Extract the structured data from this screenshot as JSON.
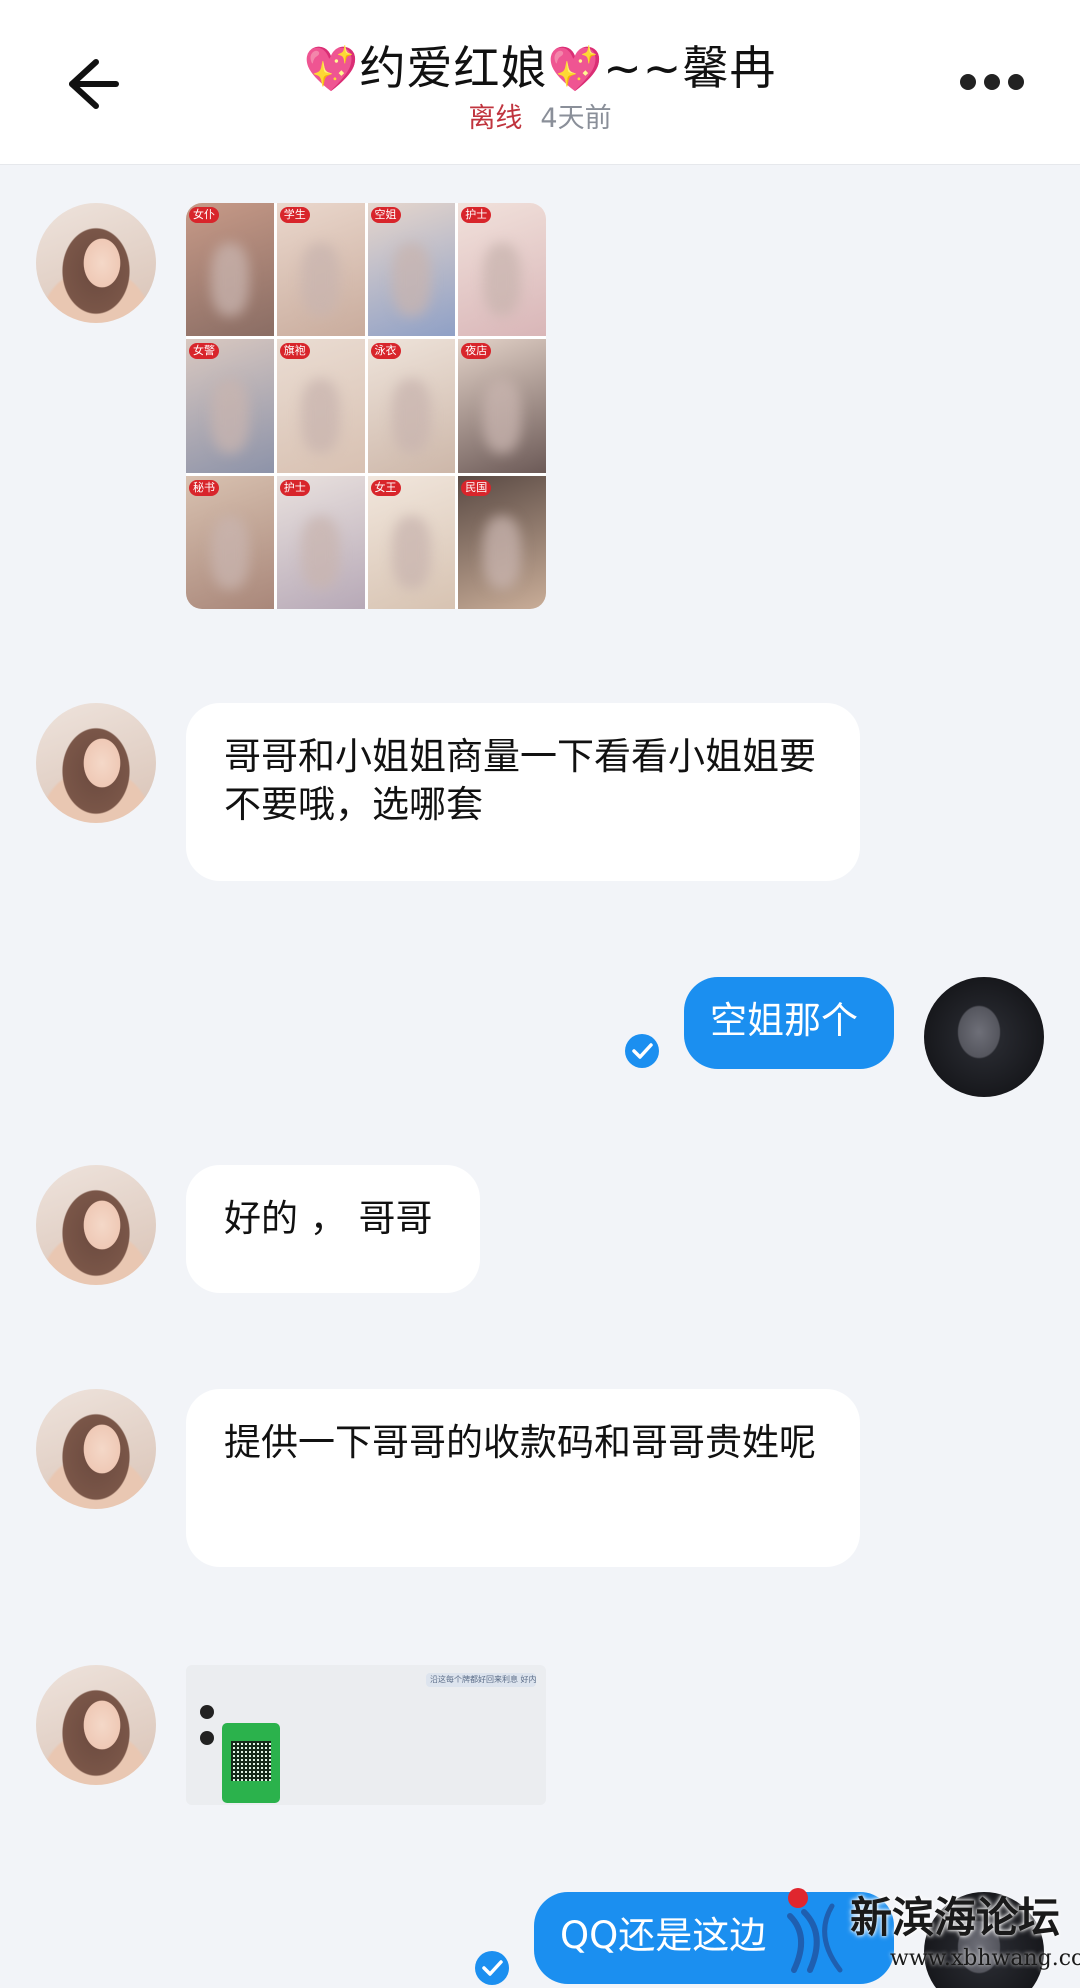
{
  "header": {
    "title_prefix_heart": "💖",
    "title_name": "约爱红娘",
    "title_suffix_heart": "💖",
    "title_tail": "~~馨冉",
    "status_offline": "离线",
    "status_time": "4天前",
    "back_icon": "arrow-left-icon",
    "more_icon": "more-horizontal-icon"
  },
  "image_grid": {
    "tags": [
      "女仆",
      "学生",
      "空姐",
      "护士",
      "女警",
      "旗袍",
      "泳衣",
      "夜店",
      "秘书",
      "护士",
      "女王",
      "民国"
    ]
  },
  "messages": {
    "m1": "哥哥和小姐姐商量一下看看小姐姐要不要哦，选哪套",
    "m2": "空姐那个",
    "m3": "好的 ， 哥哥",
    "m4": "提供一下哥哥的收款码和哥哥贵姓呢",
    "m5": "QQ还是这边"
  },
  "screenshot": {
    "top_text": "沿这每个牌都好回来利息 好内容"
  },
  "watermark": {
    "title": "新滨海论坛",
    "url": "www.xbhwang.com"
  },
  "colors": {
    "accent": "#1b8ff0",
    "background": "#f2f4f8",
    "offline": "#c0343e"
  }
}
